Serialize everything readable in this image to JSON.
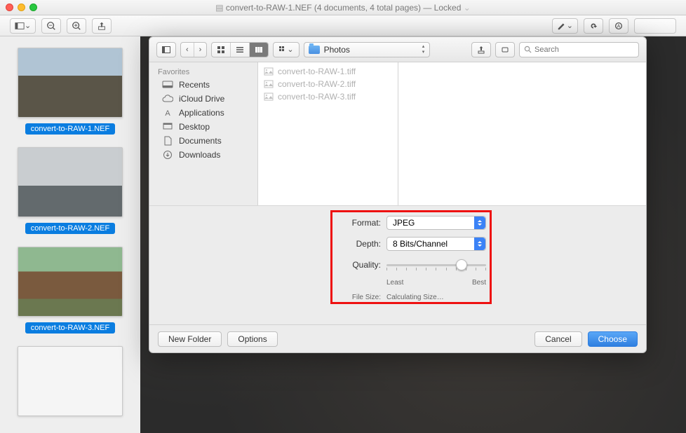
{
  "titlebar": {
    "doc_icon": "document-icon",
    "title": "convert-to-RAW-1.NEF (4 documents, 4 total pages)",
    "status": "— Locked"
  },
  "thumbs": [
    {
      "label": "convert-to-RAW-1.NEF"
    },
    {
      "label": "convert-to-RAW-2.NEF"
    },
    {
      "label": "convert-to-RAW-3.NEF"
    }
  ],
  "sheet": {
    "path_label": "Photos",
    "search_placeholder": "Search",
    "sidebar": {
      "section": "Favorites",
      "items": [
        {
          "label": "Recents"
        },
        {
          "label": "iCloud Drive"
        },
        {
          "label": "Applications"
        },
        {
          "label": "Desktop"
        },
        {
          "label": "Documents"
        },
        {
          "label": "Downloads"
        }
      ]
    },
    "files": [
      "convert-to-RAW-1.tiff",
      "convert-to-RAW-2.tiff",
      "convert-to-RAW-3.tiff"
    ],
    "options": {
      "format_label": "Format:",
      "format_value": "JPEG",
      "depth_label": "Depth:",
      "depth_value": "8 Bits/Channel",
      "quality_label": "Quality:",
      "quality_least": "Least",
      "quality_best": "Best",
      "quality_pos_pct": 75,
      "filesize_label": "File Size:",
      "filesize_value": "Calculating Size…"
    },
    "buttons": {
      "new_folder": "New Folder",
      "options": "Options",
      "cancel": "Cancel",
      "choose": "Choose"
    }
  }
}
